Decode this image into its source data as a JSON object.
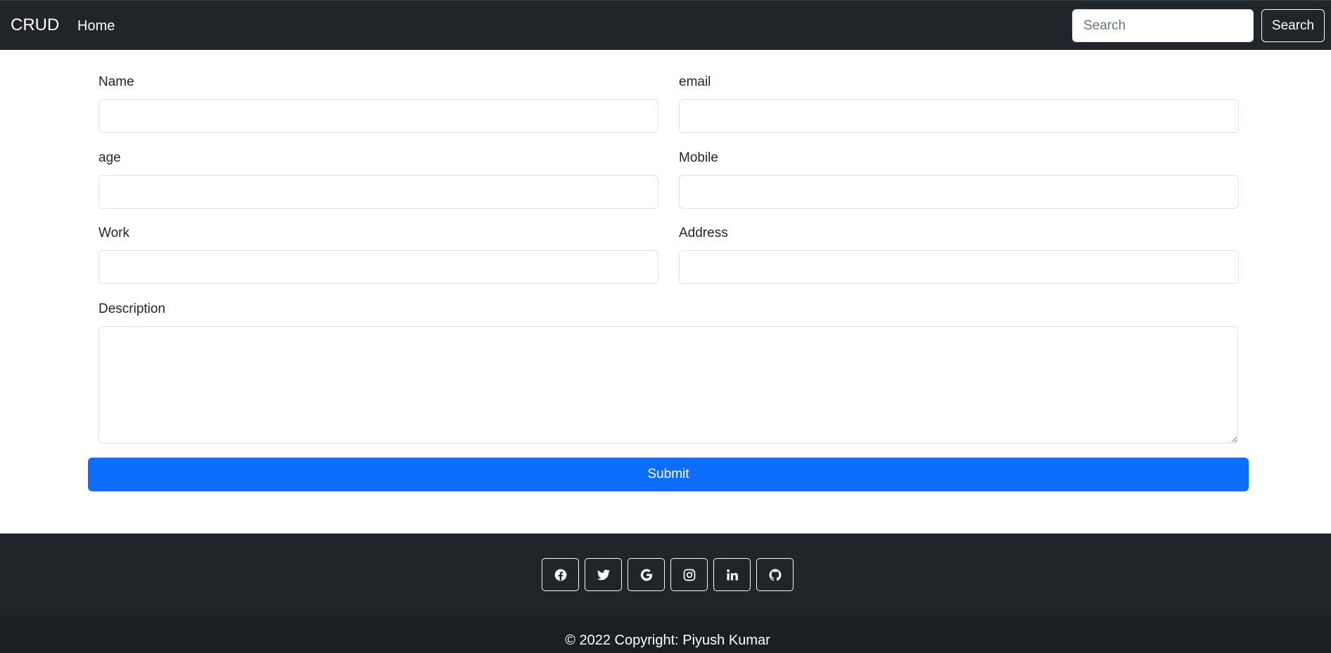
{
  "navbar": {
    "brand": "CRUD",
    "home_link": "Home",
    "search_placeholder": "Search",
    "search_button": "Search"
  },
  "form": {
    "name_label": "Name",
    "email_label": "email",
    "age_label": "age",
    "mobile_label": "Mobile",
    "work_label": "Work",
    "address_label": "Address",
    "description_label": "Description",
    "submit_label": "Submit"
  },
  "footer": {
    "social_icons": [
      "facebook-icon",
      "twitter-icon",
      "google-icon",
      "instagram-icon",
      "linkedin-icon",
      "github-icon"
    ],
    "copyright": "© 2022 Copyright:  Piyush Kumar"
  },
  "colors": {
    "navbar_bg": "#212529",
    "primary": "#0d6efd",
    "footer_bottom_bg": "#1b1f23"
  }
}
